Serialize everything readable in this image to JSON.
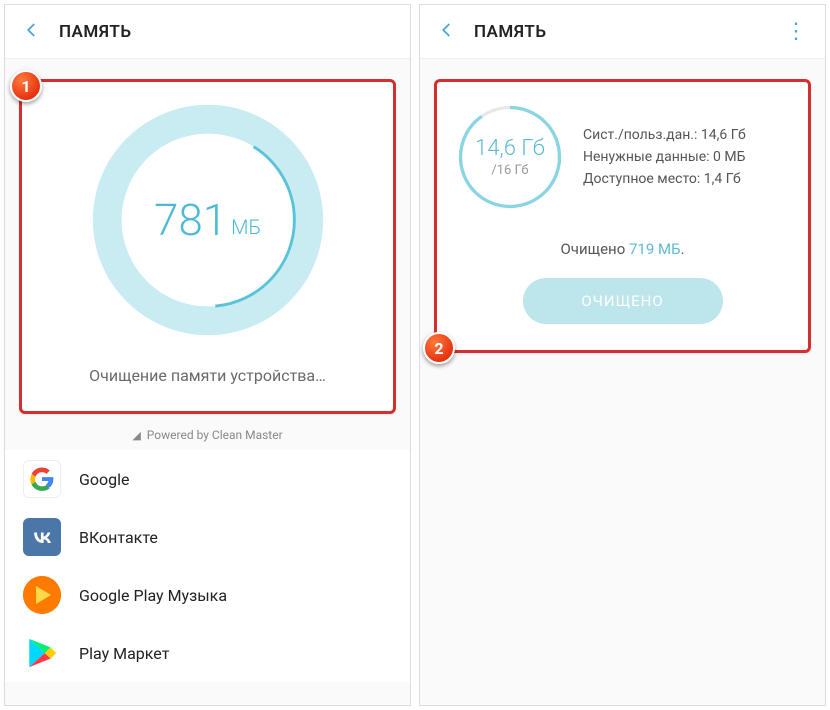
{
  "left": {
    "title": "ПАМЯТЬ",
    "badge": "1",
    "ring": {
      "value": "781",
      "unit": "МБ"
    },
    "status": "Очищение памяти устройства…",
    "powered": "Powered by Clean Master",
    "apps": [
      {
        "name": "Google"
      },
      {
        "name": "ВКонтакте"
      },
      {
        "name": "Google Play Музыка"
      },
      {
        "name": "Play Маркет"
      }
    ]
  },
  "right": {
    "title": "ПАМЯТЬ",
    "badge": "2",
    "ring": {
      "value": "14,6 Гб",
      "total": "/16 Гб"
    },
    "stats": {
      "system": "Сист./польз.дан.: 14,6 Гб",
      "junk": "Ненужные данные: 0 МБ",
      "free": "Доступное место: 1,4 Гб"
    },
    "cleaned_prefix": "Очищено ",
    "cleaned_value": "719 МБ",
    "cleaned_suffix": ".",
    "button": "ОЧИЩЕНО"
  }
}
